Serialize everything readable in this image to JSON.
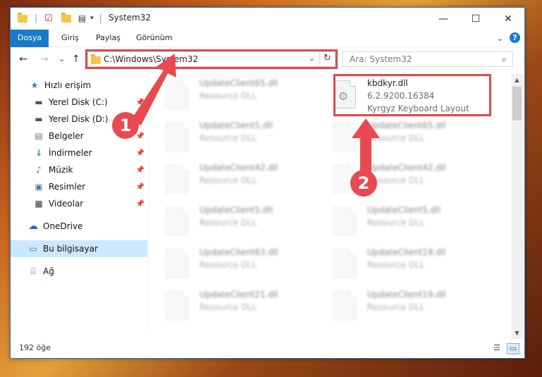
{
  "window": {
    "title": "System32",
    "minimize": "—",
    "maximize": "☐",
    "close": "✕"
  },
  "ribbon": {
    "tabs": [
      "Dosya",
      "Giriş",
      "Paylaş",
      "Görünüm"
    ],
    "expand": "⌄",
    "help": "?"
  },
  "navigation": {
    "back": "←",
    "forward": "→",
    "recent": "⌄",
    "up": "↑",
    "address": "C:\\Windows\\System32",
    "address_dropdown": "⌄",
    "refresh": "↻",
    "search_placeholder": "Ara: System32",
    "search_icon": "⌕"
  },
  "sidebar": {
    "items": [
      {
        "label": "Hızlı erişim",
        "icon": "star-icon"
      },
      {
        "label": "Yerel Disk (C:)",
        "icon": "drive-icon"
      },
      {
        "label": "Yerel Disk (D:)",
        "icon": "drive-icon"
      },
      {
        "label": "Belgeler",
        "icon": "documents-icon"
      },
      {
        "label": "İndirmeler",
        "icon": "download-icon"
      },
      {
        "label": "Müzik",
        "icon": "music-icon"
      },
      {
        "label": "Resimler",
        "icon": "pictures-icon"
      },
      {
        "label": "Videolar",
        "icon": "videos-icon"
      },
      {
        "label": "OneDrive",
        "icon": "cloud-icon"
      },
      {
        "label": "Bu bilgisayar",
        "icon": "computer-icon"
      },
      {
        "label": "Ağ",
        "icon": "network-icon"
      }
    ]
  },
  "files": {
    "highlighted": {
      "name": "kbdkyr.dll",
      "version": "6.2.9200.16384",
      "description": "Kyrgyz Keyboard Layout"
    },
    "left_column": [
      {
        "name": "UpdateClient65.dll",
        "type": "Resource DLL"
      },
      {
        "name": "UpdateClient5.dll",
        "type": "Resource DLL"
      },
      {
        "name": "UpdateClient42.dll",
        "type": "Resource DLL"
      },
      {
        "name": "UpdateClient5.dll",
        "type": "Resource DLL"
      },
      {
        "name": "UpdateClient63.dll",
        "type": "Resource DLL"
      },
      {
        "name": "UpdateClient21.dll",
        "type": "Resource DLL"
      }
    ],
    "right_column": [
      {
        "name": "UpdateClient65.dll",
        "type": "Resource DLL"
      },
      {
        "name": "UpdateClient42.dll",
        "type": "Resource DLL"
      },
      {
        "name": "UpdateClient5.dll",
        "type": "Resource DLL"
      },
      {
        "name": "UpdateClient19.dll",
        "type": "Resource DLL"
      },
      {
        "name": "UpdateClient19.dll",
        "type": "Resource DLL"
      }
    ]
  },
  "status": {
    "item_count": "192 öğe"
  },
  "annotations": {
    "step1": "1",
    "step2": "2"
  },
  "colors": {
    "accent": "#1979ca",
    "highlight": "#e0474c"
  }
}
